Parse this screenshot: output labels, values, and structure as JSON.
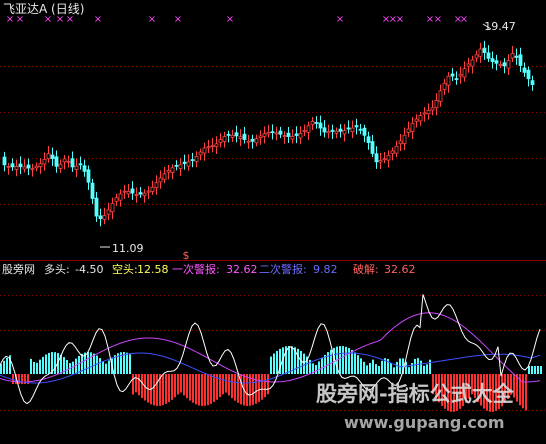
{
  "chart_data": [
    {
      "type": "candlestick",
      "title": "飞亚达A (日线)",
      "annotations": {
        "high": "19.47",
        "low": "11.09",
        "signal": "$"
      },
      "ylim": [
        10,
        20
      ],
      "colors": {
        "up": "#ff4040",
        "down": "#55ffff",
        "grid": "#8a0000"
      }
    },
    {
      "type": "line",
      "legend": [
        {
          "label": "股旁网",
          "value": "",
          "color": "#e8e8e8"
        },
        {
          "label": "多头:",
          "value": "-4.50",
          "color": "#e8e8e8"
        },
        {
          "label": "空头:",
          "value": "12.58",
          "color": "#ffff55"
        },
        {
          "label": "一次警报:",
          "value": "32.62",
          "color": "#ff55ff"
        },
        {
          "label": "二次警报:",
          "value": "9.82",
          "color": "#6a6aff"
        },
        {
          "label": "破解:",
          "value": "32.62",
          "color": "#ff6060"
        }
      ],
      "colors": {
        "white": "#ffffff",
        "magenta": "#cc44ff",
        "blue": "#4050ff",
        "histUp": "#55ffff",
        "histDown": "#ff3030"
      }
    }
  ],
  "watermark": {
    "line1": "股旁网-指标公式大全",
    "line2": "www.gupang.com"
  }
}
